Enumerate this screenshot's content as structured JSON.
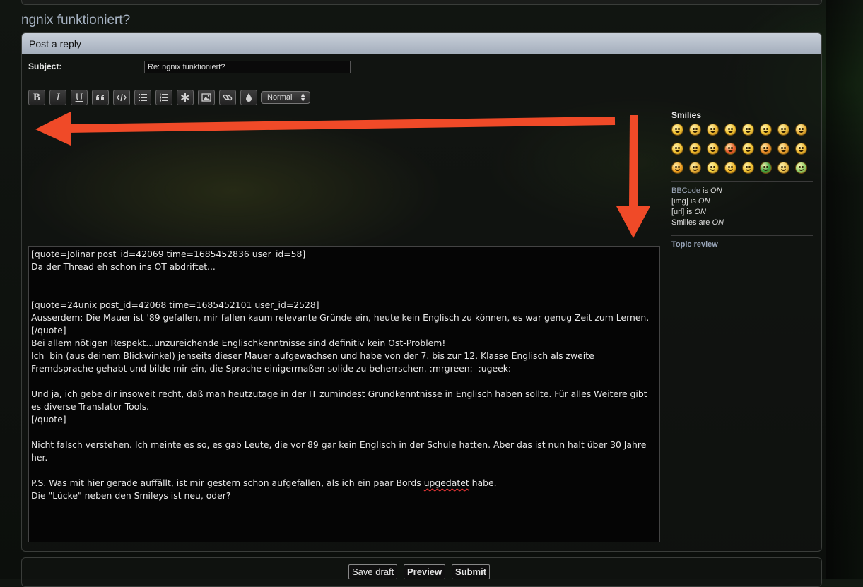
{
  "topic": {
    "title": "ngnix funktioniert?"
  },
  "panel": {
    "heading": "Post a reply"
  },
  "subject": {
    "label": "Subject:",
    "value": "Re: ngnix funktioniert?"
  },
  "toolbar": {
    "buttons": [
      "bold-icon",
      "italic-icon",
      "underline-icon",
      "quote-icon",
      "code-icon",
      "list-icon",
      "ordered-list-icon",
      "list-item-icon",
      "image-icon",
      "link-icon",
      "color-icon"
    ],
    "bold_label": "B",
    "italic_label": "I",
    "underline_label": "U",
    "font_size": "Normal"
  },
  "editor": {
    "lines_before_spell": "[quote=Jolinar post_id=42069 time=1685452836 user_id=58]\nDa der Thread eh schon ins OT abdriftet...\n\n\n[quote=24unix post_id=42068 time=1685452101 user_id=2528]\nAusserdem: Die Mauer ist '89 gefallen, mir fallen kaum relevante Gründe ein, heute kein Englisch zu können, es war genug Zeit zum Lernen.\n[/quote]\nBei allem nötigen Respekt...unzureichende Englischkenntnisse sind definitiv kein Ost-Problem!\nIch  bin (aus deinem Blickwinkel) jenseits dieser Mauer aufgewachsen und habe von der 7. bis zur 12. Klasse Englisch als zweite\nFremdsprache gehabt und bilde mir ein, die Sprache einigermaßen solide zu beherrschen. :mrgreen:  :ugeek:\n\nUnd ja, ich gebe dir insoweit recht, daß man heutzutage in der IT zumindest Grundkenntnisse in Englisch haben sollte. Für alles Weitere gibt\nes diverse Translator Tools.\n[/quote]\n\nNicht falsch verstehen. Ich meinte es so, es gab Leute, die vor 89 gar kein Englisch in der Schule hatten. Aber das ist nun halt über 30 Jahre\nher.\n\nP.S. Was mit hier gerade auffällt, ist mir gestern schon aufgefallen, als ich ein paar Bords ",
    "spell_word": "upgedatet",
    "lines_after_spell": " habe.\nDie \"Lücke\" neben den Smileys ist neu, oder?"
  },
  "sidebar": {
    "smilies_title": "Smilies",
    "smilies": [
      {
        "name": "smiley-laughing-icon",
        "color": "#f2c230"
      },
      {
        "name": "smiley-grin-icon",
        "color": "#f0c040"
      },
      {
        "name": "smiley-wink-icon",
        "color": "#eeb830"
      },
      {
        "name": "smiley-happy-icon",
        "color": "#f2c230"
      },
      {
        "name": "smiley-surprised-icon",
        "color": "#f4cc40"
      },
      {
        "name": "smiley-eek-icon",
        "color": "#f2c230"
      },
      {
        "name": "smiley-geek-icon",
        "color": "#e8b838"
      },
      {
        "name": "smiley-cool-icon",
        "color": "#e8b038"
      },
      {
        "name": "smiley-lol-icon",
        "color": "#f2c230"
      },
      {
        "name": "smiley-mad-icon",
        "color": "#f0b828"
      },
      {
        "name": "smiley-razz-icon",
        "color": "#eeb830"
      },
      {
        "name": "smiley-redface-icon",
        "color": "#e8562a"
      },
      {
        "name": "smiley-cry-icon",
        "color": "#f2c230"
      },
      {
        "name": "smiley-evil-icon",
        "color": "#e88a28"
      },
      {
        "name": "smiley-twisted-icon",
        "color": "#e8a030"
      },
      {
        "name": "smiley-roll-icon",
        "color": "#eeb830"
      },
      {
        "name": "smiley-exclaim-icon",
        "color": "#f0a020"
      },
      {
        "name": "smiley-question-icon",
        "color": "#e8b038"
      },
      {
        "name": "smiley-idea-icon",
        "color": "#f2d040"
      },
      {
        "name": "smiley-arrow-icon",
        "color": "#f0b828"
      },
      {
        "name": "smiley-neutral-icon",
        "color": "#f2c230"
      },
      {
        "name": "smiley-mrgreen-icon",
        "color": "#35a040"
      },
      {
        "name": "smiley-ugeek-icon",
        "color": "#e8c050"
      },
      {
        "name": "smiley-nerd-icon",
        "color": "#8ccf6a"
      }
    ],
    "bbcode_link": "BBCode",
    "bbcode_is": " is ",
    "bbcode_state": "ON",
    "img_label": "[img] is ",
    "img_state": "ON",
    "url_label": "[url] is ",
    "url_state": "ON",
    "smilies_label": "Smilies are ",
    "smilies_state": "ON",
    "topic_review": "Topic review"
  },
  "actions": {
    "save_draft": "Save draft",
    "preview": "Preview",
    "submit": "Submit"
  },
  "colors": {
    "annotation_arrow": "#f04a28",
    "header_bg": "#b8c0cc"
  }
}
